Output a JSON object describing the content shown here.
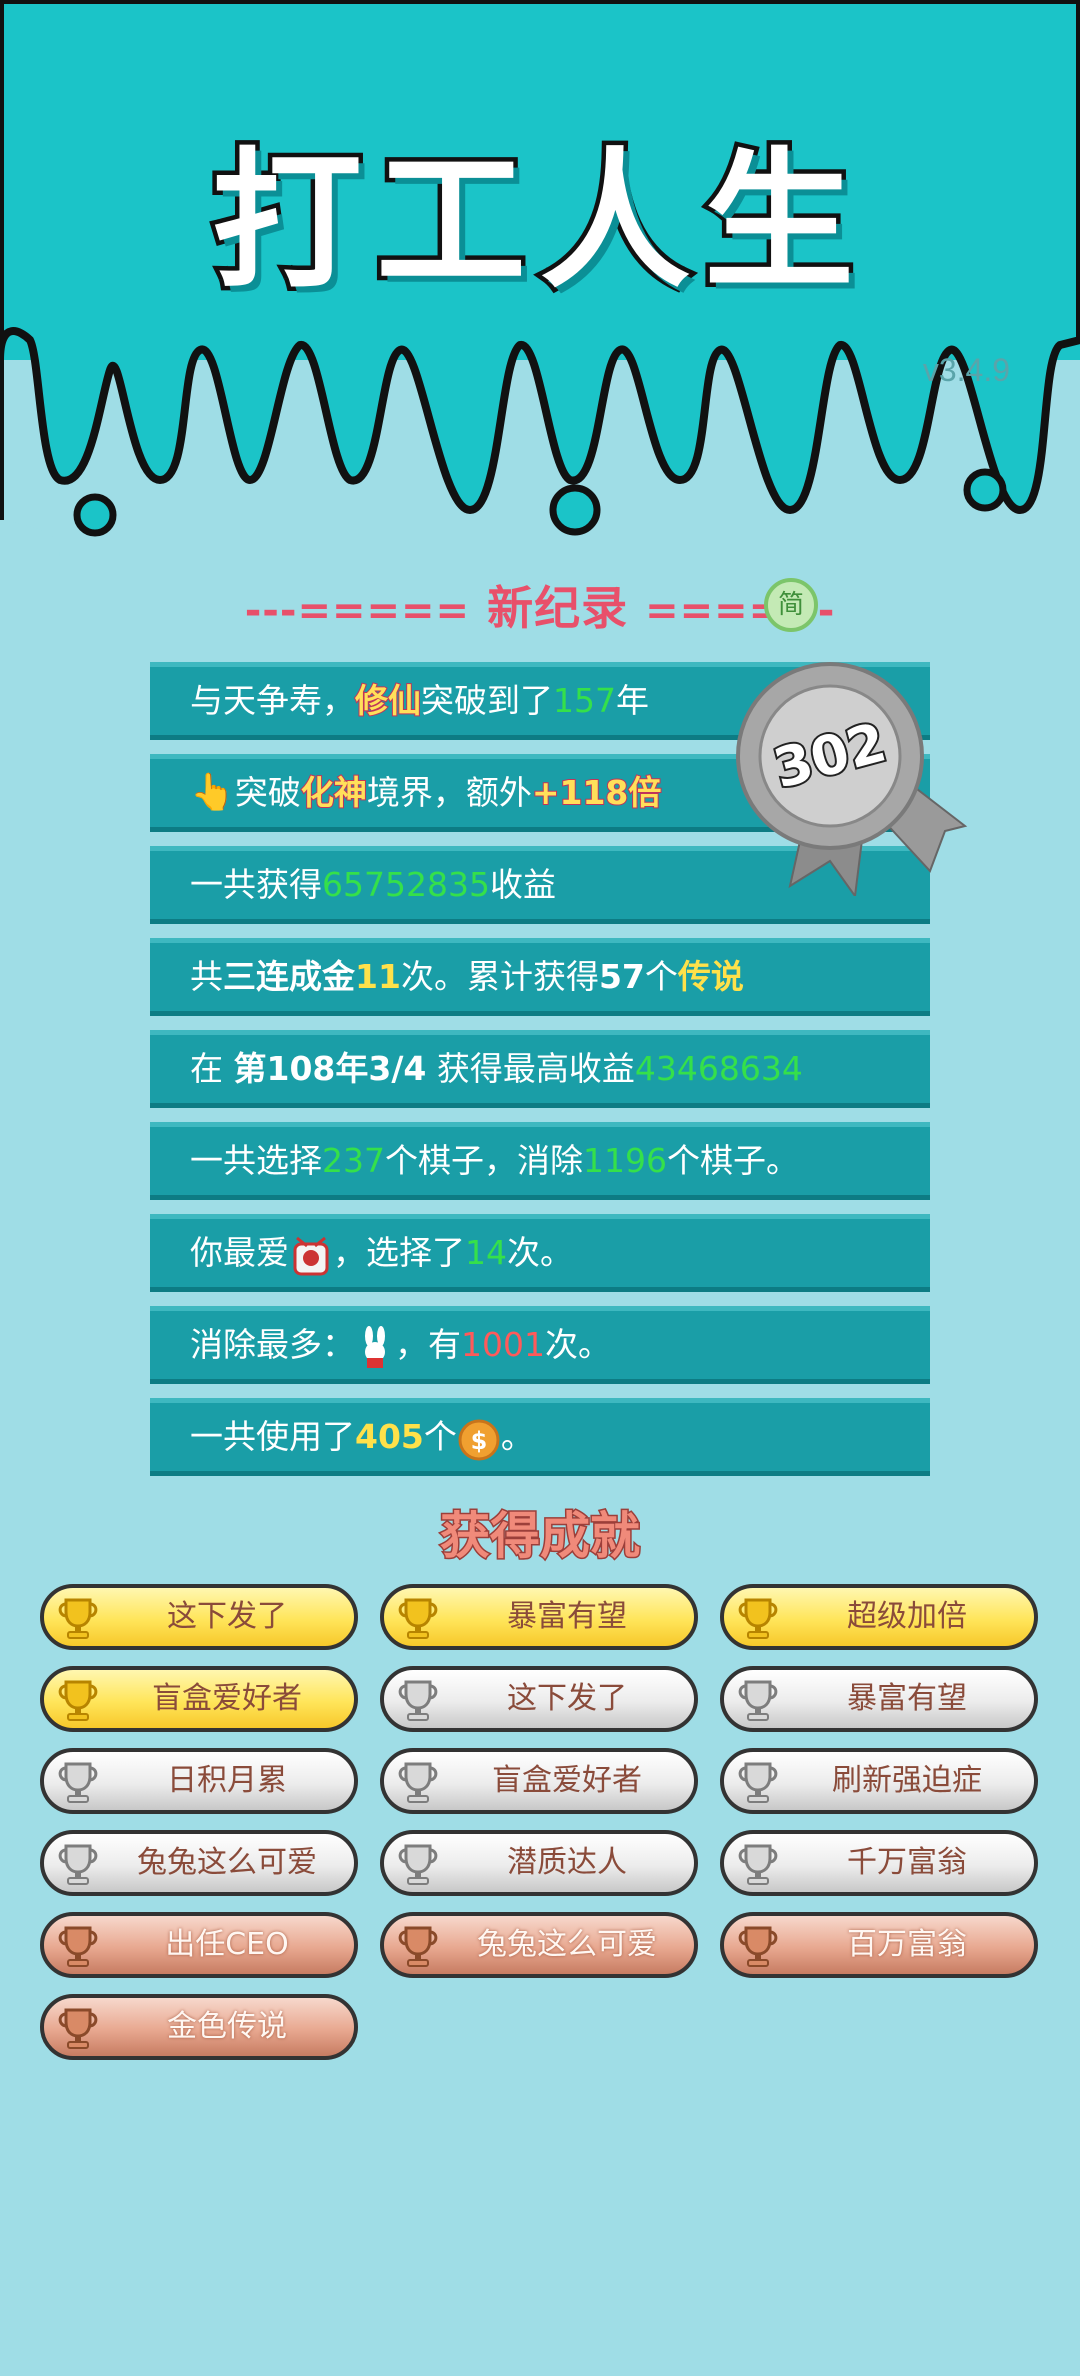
{
  "header": {
    "title": "打工人生",
    "version": "v3.4.9"
  },
  "record": {
    "title": "新纪录",
    "left_deco": "---=====",
    "right_deco": "=====-",
    "simp_button": "简",
    "badge_value": "302"
  },
  "rows": {
    "r1": {
      "a": "与天争寿，",
      "b": "修仙",
      "c": "突破到了",
      "d": "157",
      "e": "年"
    },
    "r2": {
      "a": "突破",
      "b": "化神",
      "c": "境界，额外",
      "d": "+118倍"
    },
    "r3": {
      "a": "一共获得",
      "b": "65752835",
      "c": "收益"
    },
    "r4": {
      "a": "共",
      "b": "三连成金",
      "c": "11",
      "d": "次。累计获得",
      "e": "57",
      "f": "个",
      "g": "传说"
    },
    "r5": {
      "a": "在 ",
      "b": "第108年3/4",
      "c": " 获得最高收益",
      "d": "43468634"
    },
    "r6": {
      "a": "一共选择",
      "b": "237",
      "c": "个棋子，消除",
      "d": "1196",
      "e": "个棋子。"
    },
    "r7": {
      "a": "你最爱",
      "b": "，选择了",
      "c": "14",
      "d": "次。"
    },
    "r8": {
      "a": "消除最多：",
      "b": "，有",
      "c": "1001",
      "d": "次。"
    },
    "r9": {
      "a": "一共使用了",
      "b": "405",
      "c": "个",
      "d": "。"
    }
  },
  "achievements_title": "获得成就",
  "achievements": [
    {
      "label": "这下发了",
      "tier": "gold"
    },
    {
      "label": "暴富有望",
      "tier": "gold"
    },
    {
      "label": "超级加倍",
      "tier": "gold"
    },
    {
      "label": "盲盒爱好者",
      "tier": "gold"
    },
    {
      "label": "这下发了",
      "tier": "silver"
    },
    {
      "label": "暴富有望",
      "tier": "silver"
    },
    {
      "label": "日积月累",
      "tier": "silver"
    },
    {
      "label": "盲盒爱好者",
      "tier": "silver"
    },
    {
      "label": "刷新强迫症",
      "tier": "silver"
    },
    {
      "label": "兔兔这么可爱",
      "tier": "silver"
    },
    {
      "label": "潜质达人",
      "tier": "silver"
    },
    {
      "label": "千万富翁",
      "tier": "silver"
    },
    {
      "label": "出任CEO",
      "tier": "bronze"
    },
    {
      "label": "兔兔这么可爱",
      "tier": "bronze"
    },
    {
      "label": "百万富翁",
      "tier": "bronze"
    },
    {
      "label": "金色传说",
      "tier": "bronze"
    }
  ],
  "colors": {
    "header_bg": "#1bc4c8",
    "page_bg": "#9fdde6",
    "row_bg": "#1a9ea7",
    "green": "#35e04a",
    "yellow": "#ffe14a",
    "red": "#ff5a5a"
  }
}
